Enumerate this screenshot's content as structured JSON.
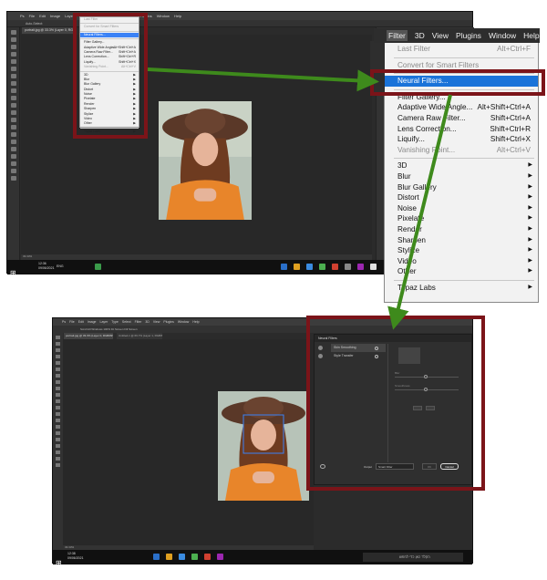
{
  "colors": {
    "highlight_box": "#7b1419",
    "arrow": "#3e8a1c",
    "menu_highlight": "#1a73d9",
    "ps_background": "#2b2b2b"
  },
  "screenshot1": {
    "menubar": [
      "Ps",
      "File",
      "Edit",
      "Image",
      "Layer",
      "Type",
      "Select",
      "Filter",
      "3D",
      "View",
      "Plugins",
      "Window",
      "Help"
    ],
    "options_bar": "Auto-Select:",
    "document_tab": "portrait.jpg @ 33.3% (Layer 0, RGB/8#) *",
    "status_bar": "33.33%",
    "taskbar": {
      "time": "12:36",
      "date": "09/06/2021",
      "lang": "ENG"
    },
    "filter_menu": {
      "items": [
        {
          "label": "Last Filter",
          "shortcut": "",
          "dim": true
        },
        {
          "sep": true
        },
        {
          "label": "Convert for Smart Filters",
          "shortcut": "",
          "dim": true
        },
        {
          "sep": true
        },
        {
          "label": "Neural Filters...",
          "shortcut": "",
          "hl": true
        },
        {
          "sep": true
        },
        {
          "label": "Filter Gallery...",
          "shortcut": ""
        },
        {
          "label": "Adaptive Wide Angle...",
          "shortcut": "Alt+Shift+Ctrl+A"
        },
        {
          "label": "Camera Raw Filter...",
          "shortcut": "Shift+Ctrl+A"
        },
        {
          "label": "Lens Correction...",
          "shortcut": "Shift+Ctrl+R"
        },
        {
          "label": "Liquify...",
          "shortcut": "Shift+Ctrl+X"
        },
        {
          "label": "Vanishing Point...",
          "shortcut": "Alt+Ctrl+V",
          "dim": true
        },
        {
          "sep": true
        },
        {
          "label": "3D",
          "arrow": true
        },
        {
          "label": "Blur",
          "arrow": true
        },
        {
          "label": "Blur Gallery",
          "arrow": true
        },
        {
          "label": "Distort",
          "arrow": true
        },
        {
          "label": "Noise",
          "arrow": true
        },
        {
          "label": "Pixelate",
          "arrow": true
        },
        {
          "label": "Render",
          "arrow": true
        },
        {
          "label": "Sharpen",
          "arrow": true
        },
        {
          "label": "Stylize",
          "arrow": true
        },
        {
          "label": "Video",
          "arrow": true
        },
        {
          "label": "Other",
          "arrow": true
        },
        {
          "sep": true
        },
        {
          "label": "Topaz Labs",
          "arrow": true
        }
      ]
    }
  },
  "zoom_menu": {
    "menubar": [
      "Filter",
      "3D",
      "View",
      "Plugins",
      "Window",
      "Help"
    ],
    "items": [
      {
        "label": "Last Filter",
        "shortcut": "Alt+Ctrl+F",
        "dim": true
      },
      {
        "sep": true
      },
      {
        "label": "Convert for Smart Filters",
        "shortcut": "",
        "dim": true
      },
      {
        "sep": true
      },
      {
        "label": "Neural Filters...",
        "shortcut": "",
        "hl": true
      },
      {
        "sep": true
      },
      {
        "label": "Filter Gallery...",
        "shortcut": ""
      },
      {
        "label": "Adaptive Wide Angle...",
        "shortcut": "Alt+Shift+Ctrl+A"
      },
      {
        "label": "Camera Raw Filter...",
        "shortcut": "Shift+Ctrl+A"
      },
      {
        "label": "Lens Correction...",
        "shortcut": "Shift+Ctrl+R"
      },
      {
        "label": "Liquify...",
        "shortcut": "Shift+Ctrl+X"
      },
      {
        "label": "Vanishing Point...",
        "shortcut": "Alt+Ctrl+V",
        "dim": true
      },
      {
        "sep": true
      },
      {
        "label": "3D",
        "arrow": true
      },
      {
        "label": "Blur",
        "arrow": true
      },
      {
        "label": "Blur Gallery",
        "arrow": true
      },
      {
        "label": "Distort",
        "arrow": true
      },
      {
        "label": "Noise",
        "arrow": true
      },
      {
        "label": "Pixelate",
        "arrow": true
      },
      {
        "label": "Render",
        "arrow": true
      },
      {
        "label": "Sharpen",
        "arrow": true
      },
      {
        "label": "Stylize",
        "arrow": true
      },
      {
        "label": "Video",
        "arrow": true
      },
      {
        "label": "Other",
        "arrow": true
      },
      {
        "sep": true
      },
      {
        "label": "Topaz Labs",
        "arrow": true
      }
    ]
  },
  "screenshot2": {
    "menubar": [
      "Ps",
      "File",
      "Edit",
      "Image",
      "Layer",
      "Type",
      "Select",
      "Filter",
      "3D",
      "View",
      "Plugins",
      "Window",
      "Help"
    ],
    "options_bar": "Scroll All Windows   100%   Fit Screen   Fill Screen",
    "document_tab": "portrait.jpg @ 33.3% (Layer 0, RGB/8#) *",
    "document_tab2": "Untitled-1 @ 66.7% (Layer 1, RGB/8#)",
    "status_bar": "33.33%",
    "taskbar": {
      "time": "12:38",
      "date": "09/06/2021",
      "search": "הקלד כאן כדי לחפש"
    },
    "neural_filters": {
      "title": "Neural Filters",
      "filters": [
        {
          "label": "Skin Smoothing",
          "selected": true
        },
        {
          "label": "Style Transfer",
          "selected": false
        }
      ],
      "props": [
        "Blur",
        "Smoothness"
      ],
      "output_label": "Output",
      "output_value": "Smart Filter",
      "ok_label": "OK",
      "cancel_label": "Cancel"
    }
  }
}
